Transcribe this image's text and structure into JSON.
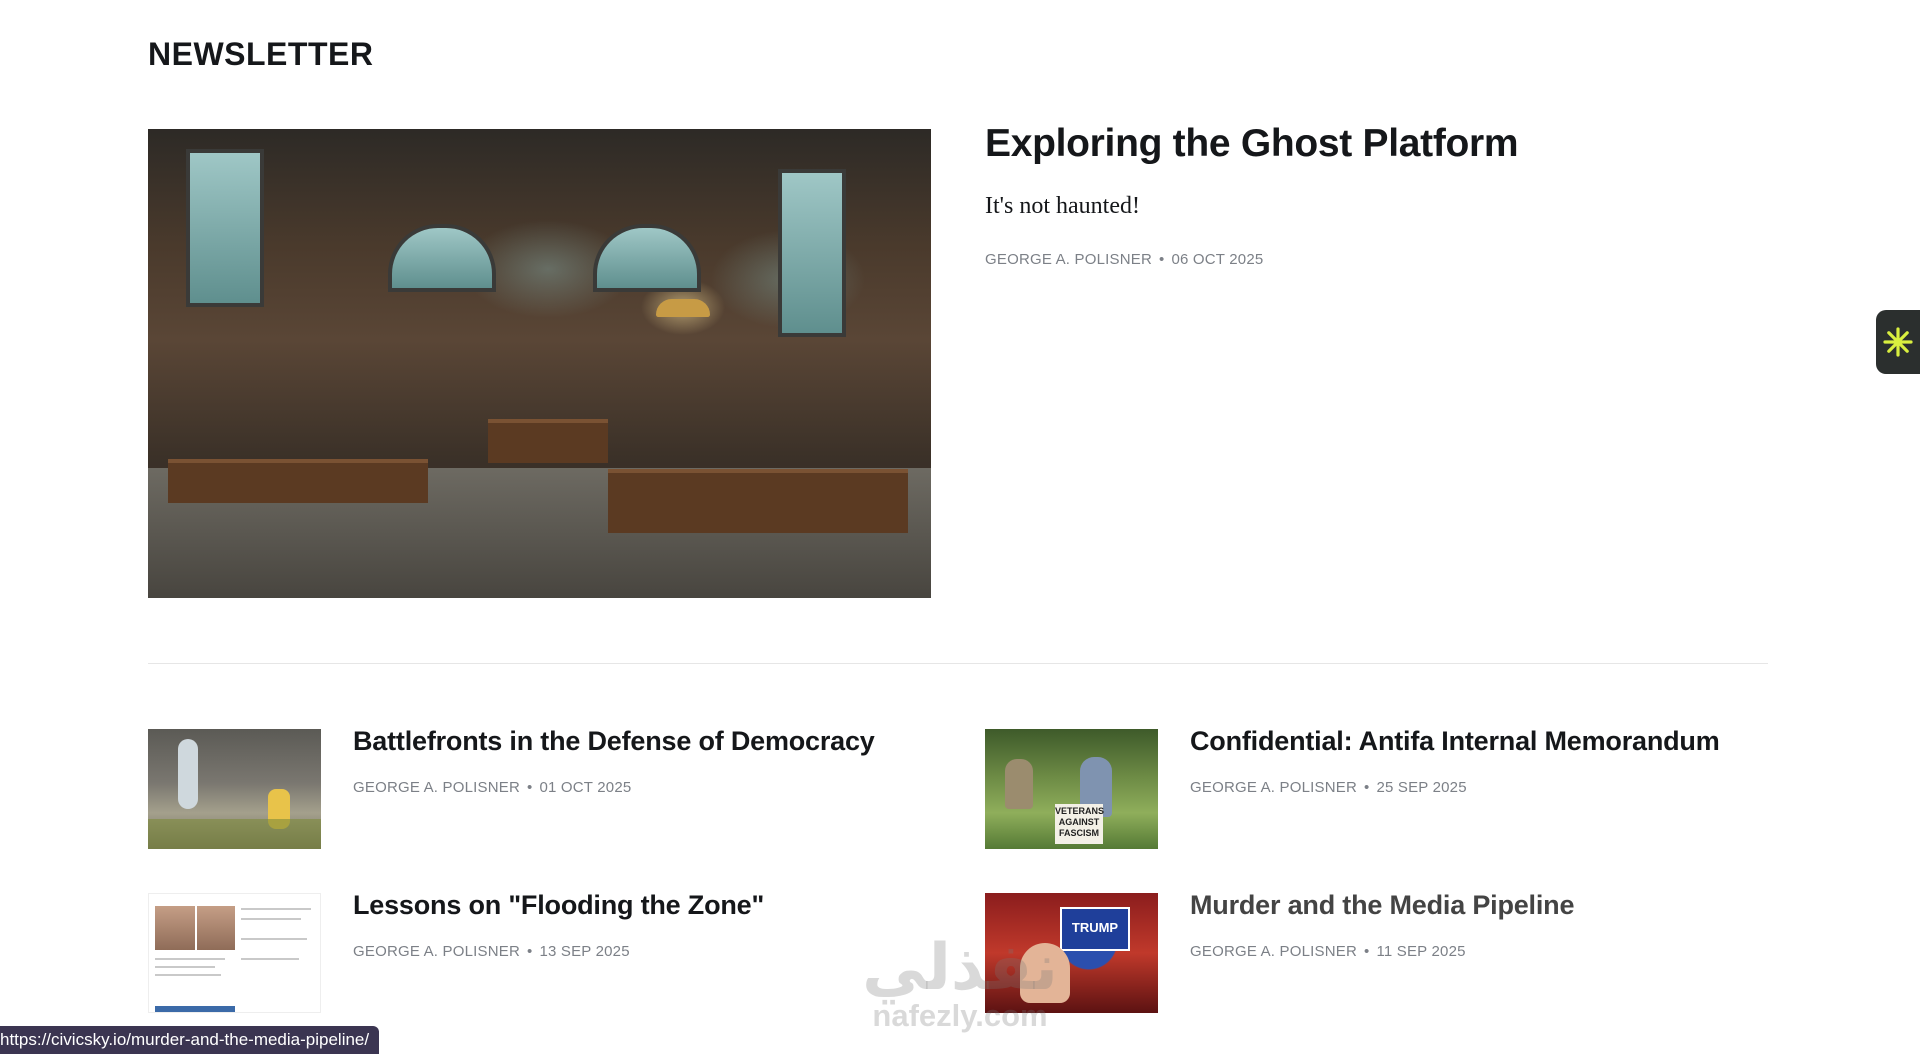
{
  "section": {
    "title": "NEWSLETTER"
  },
  "featured": {
    "title": "Exploring the Ghost Platform",
    "excerpt": "It's not haunted!",
    "author": "GEORGE A. POLISNER",
    "separator": "•",
    "date": "06 OCT 2025"
  },
  "posts": [
    {
      "title": "Battlefronts in the Defense of Democracy",
      "author": "GEORGE A. POLISNER",
      "separator": "•",
      "date": "01 OCT 2025"
    },
    {
      "title": "Confidential: Antifa Internal Memorandum",
      "author": "GEORGE A. POLISNER",
      "separator": "•",
      "date": "25 SEP 2025",
      "image_text": "VETERANS AGAINST FASCISM"
    },
    {
      "title": "Lessons on \"Flooding the Zone\"",
      "author": "GEORGE A. POLISNER",
      "separator": "•",
      "date": "13 SEP 2025"
    },
    {
      "title": "Murder and the Media Pipeline",
      "author": "GEORGE A. POLISNER",
      "separator": "•",
      "date": "11 SEP 2025",
      "image_text": "TRUMP"
    }
  ],
  "side_widget": {
    "icon": "asterisk-icon",
    "color": "#d9ef3f"
  },
  "status_bar": {
    "url": "https://civicsky.io/murder-and-the-media-pipeline/"
  },
  "watermark": {
    "arabic": "نفذلي",
    "latin": "nafezly.com"
  }
}
